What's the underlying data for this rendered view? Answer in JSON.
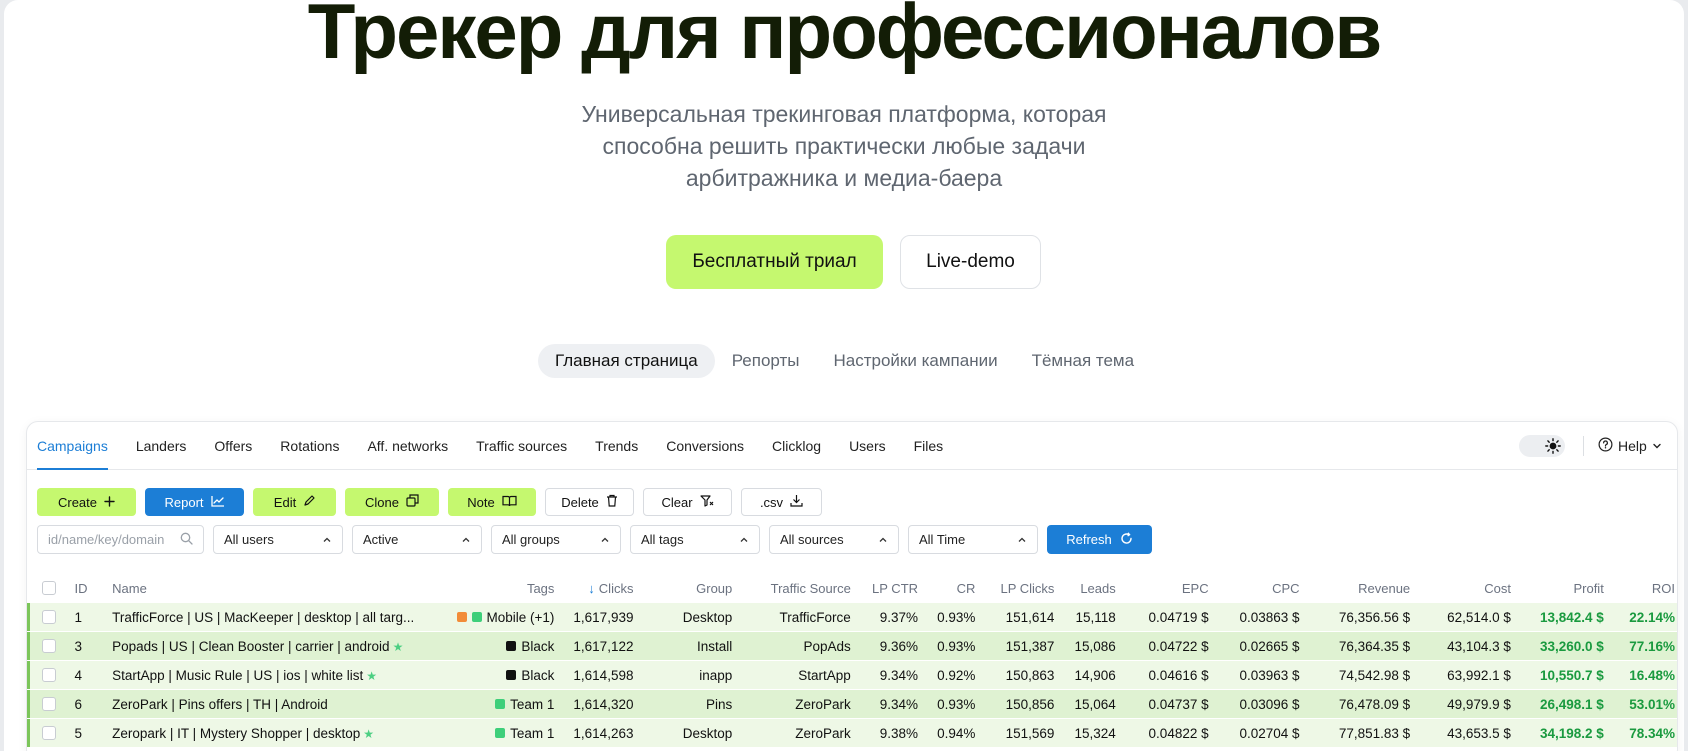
{
  "hero": {
    "title": "Трекер для профессионалов",
    "subtitle_lines": [
      "Универсальная трекинговая платформа, которая",
      "способна решить практически любые задачи",
      "арбитражника и медиа-баера"
    ],
    "trial_button": "Бесплатный триал",
    "demo_button": "Live-demo"
  },
  "view_switcher": [
    "Главная страница",
    "Репорты",
    "Настройки кампании",
    "Тёмная тема"
  ],
  "app": {
    "nav_tabs": [
      "Campaigns",
      "Landers",
      "Offers",
      "Rotations",
      "Aff. networks",
      "Traffic sources",
      "Trends",
      "Conversions",
      "Clicklog",
      "Users",
      "Files"
    ],
    "help_label": "Help",
    "toolbar": {
      "create": "Create",
      "report": "Report",
      "edit": "Edit",
      "clone": "Clone",
      "note": "Note",
      "delete": "Delete",
      "clear": "Clear",
      "csv": ".csv"
    },
    "filters": {
      "search_placeholder": "id/name/key/domain",
      "users": "All users",
      "status": "Active",
      "groups": "All groups",
      "tags": "All tags",
      "sources": "All sources",
      "time": "All Time",
      "refresh": "Refresh"
    },
    "columns": {
      "id": "ID",
      "name": "Name",
      "tags": "Tags",
      "clicks": "Clicks",
      "group": "Group",
      "source": "Traffic Source",
      "lpctr": "LP CTR",
      "cr": "CR",
      "lpclicks": "LP Clicks",
      "leads": "Leads",
      "epc": "EPC",
      "cpc": "CPC",
      "revenue": "Revenue",
      "cost": "Cost",
      "profit": "Profit",
      "roi": "ROI"
    },
    "rows": [
      {
        "id": "1",
        "name": "TrafficForce | US | MacKeeper | desktop | all targ...",
        "star": false,
        "tag": "Mobile (+1)",
        "tag_colors": [
          "#f28c38",
          "#3ecf7a"
        ],
        "clicks": "1,617,939",
        "group": "Desktop",
        "source": "TrafficForce",
        "lpctr": "9.37%",
        "cr": "0.93%",
        "lpclicks": "151,614",
        "leads": "15,118",
        "epc": "0.04719 $",
        "cpc": "0.03863 $",
        "revenue": "76,356.56 $",
        "cost": "62,514.0 $",
        "profit": "13,842.4 $",
        "roi": "22.14%"
      },
      {
        "id": "3",
        "name": "Popads | US | Clean Booster | carrier | android",
        "star": true,
        "tag": "Black",
        "tag_colors": [
          "#111111"
        ],
        "clicks": "1,617,122",
        "group": "Install",
        "source": "PopAds",
        "lpctr": "9.36%",
        "cr": "0.93%",
        "lpclicks": "151,387",
        "leads": "15,086",
        "epc": "0.04722 $",
        "cpc": "0.02665 $",
        "revenue": "76,364.35 $",
        "cost": "43,104.3 $",
        "profit": "33,260.0 $",
        "roi": "77.16%"
      },
      {
        "id": "4",
        "name": "StartApp | Music Rule | US | ios | white list",
        "star": true,
        "tag": "Black",
        "tag_colors": [
          "#111111"
        ],
        "clicks": "1,614,598",
        "group": "inapp",
        "source": "StartApp",
        "lpctr": "9.34%",
        "cr": "0.92%",
        "lpclicks": "150,863",
        "leads": "14,906",
        "epc": "0.04616 $",
        "cpc": "0.03963 $",
        "revenue": "74,542.98 $",
        "cost": "63,992.1 $",
        "profit": "10,550.7 $",
        "roi": "16.48%"
      },
      {
        "id": "6",
        "name": "ZeroPark | Pins offers | TH | Android",
        "star": false,
        "tag": "Team 1",
        "tag_colors": [
          "#3ecf7a"
        ],
        "clicks": "1,614,320",
        "group": "Pins",
        "source": "ZeroPark",
        "lpctr": "9.34%",
        "cr": "0.93%",
        "lpclicks": "150,856",
        "leads": "15,064",
        "epc": "0.04737 $",
        "cpc": "0.03096 $",
        "revenue": "76,478.09 $",
        "cost": "49,979.9 $",
        "profit": "26,498.1 $",
        "roi": "53.01%"
      },
      {
        "id": "5",
        "name": "Zeropark | IT | Mystery Shopper | desktop",
        "star": true,
        "tag": "Team 1",
        "tag_colors": [
          "#3ecf7a"
        ],
        "clicks": "1,614,263",
        "group": "Desktop",
        "source": "ZeroPark",
        "lpctr": "9.38%",
        "cr": "0.94%",
        "lpclicks": "151,569",
        "leads": "15,324",
        "epc": "0.04822 $",
        "cpc": "0.02704 $",
        "revenue": "77,851.83 $",
        "cost": "43,653.5 $",
        "profit": "34,198.2 $",
        "roi": "78.34%"
      }
    ]
  },
  "colors": {
    "accent_green": "#c5f86f",
    "accent_blue": "#1c7ed6",
    "profit_green": "#1a9a3f"
  }
}
